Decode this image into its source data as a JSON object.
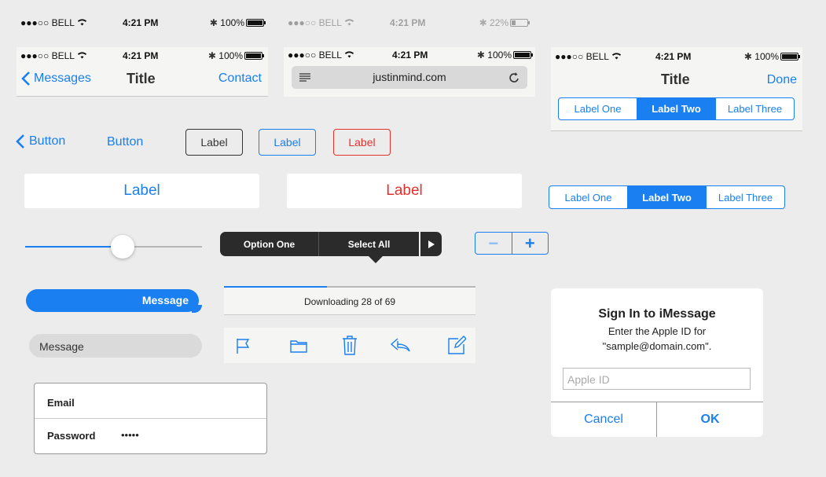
{
  "status_bar": {
    "carrier": "●●●○○ BELL",
    "time": "4:21 PM",
    "battery": "100%"
  },
  "status_bar_faded": {
    "carrier": "●●●○○ BELL",
    "time": "4:21 PM",
    "battery": "22%"
  },
  "nav1": {
    "back": "Messages",
    "title": "Title",
    "action": "Contact"
  },
  "safari": {
    "url": "justinmind.com"
  },
  "nav3": {
    "title": "Title",
    "action": "Done",
    "segments": [
      "Label One",
      "Label Two",
      "Label Three"
    ],
    "selected": 1
  },
  "buttons": {
    "back": "Button",
    "plain": "Button",
    "label_dark": "Label",
    "label_blue": "Label",
    "label_red": "Label"
  },
  "wide_buttons": {
    "blue": "Label",
    "red": "Label"
  },
  "segmented": {
    "items": [
      "Label One",
      "Label Two",
      "Label Three"
    ],
    "selected": 1
  },
  "slider": {
    "value": 0.55
  },
  "menu": {
    "option_one": "Option One",
    "select_all": "Select All"
  },
  "stepper": {
    "minus": "−",
    "plus": "+"
  },
  "bubble": {
    "sent": "Message"
  },
  "message_input": {
    "placeholder": "Message"
  },
  "progress": {
    "label": "Downloading 28 of 69",
    "value": 0.41
  },
  "toolbar": {
    "icons": [
      "flag-icon",
      "folder-icon",
      "trash-icon",
      "reply-icon",
      "compose-icon"
    ]
  },
  "form": {
    "email_label": "Email",
    "password_label": "Password",
    "password_value": "•••••"
  },
  "alert": {
    "title": "Sign In to iMessage",
    "message_line1": "Enter the Apple ID for",
    "message_line2": "\"sample@domain.com\".",
    "input_placeholder": "Apple ID",
    "cancel": "Cancel",
    "ok": "OK"
  },
  "colors": {
    "accent": "#1a7ff0",
    "destructive": "#e5312c",
    "dark_menu": "#2b2b2b",
    "background": "#ececec"
  }
}
